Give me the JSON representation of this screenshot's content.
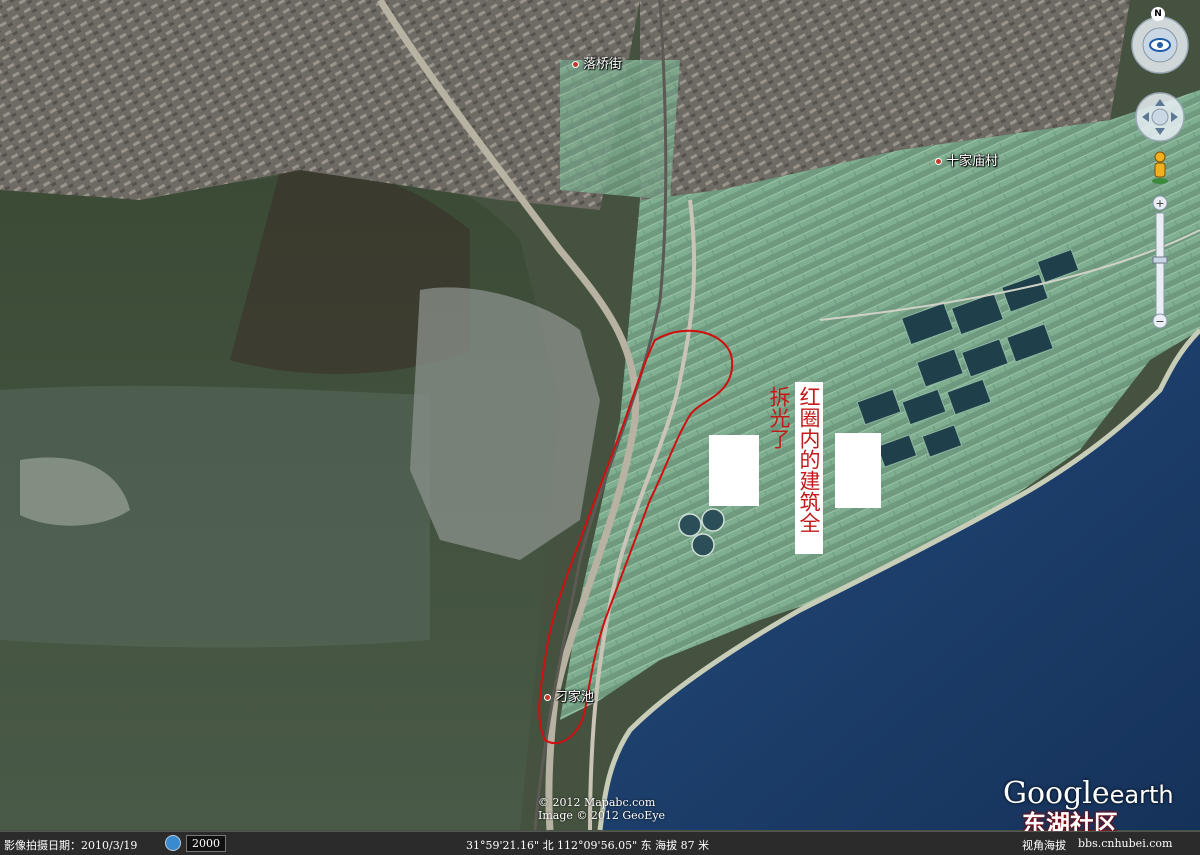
{
  "places": {
    "luoqiao": "落桥街",
    "shijia": "十家庙村",
    "diaojiachi": "刁家池"
  },
  "annotation": {
    "col1": "红圈内的建筑全",
    "col2": "拆光了"
  },
  "copyright": {
    "line1": "© 2012 Mapabc.com",
    "line2": "Image © 2012 GeoEye"
  },
  "status": {
    "date": "影像拍摄日期：2010/3/19",
    "zoom": "2000",
    "coords": "31°59'21.16\" 北 112°09'56.05\" 东 海拔   87 米",
    "altitude": "视角海拔"
  },
  "logo": {
    "word1": "Google",
    "word2": "earth"
  },
  "watermark": {
    "text": "东湖社区",
    "url": "bbs.cnhubei.com"
  },
  "nav": {
    "north": "N"
  },
  "colors": {
    "water": "#1a3a63",
    "land_dark": "#2f3c2a",
    "farmland": "#5e8a6e",
    "annotation_red": "#c21a1a",
    "route_red": "#d01010"
  }
}
